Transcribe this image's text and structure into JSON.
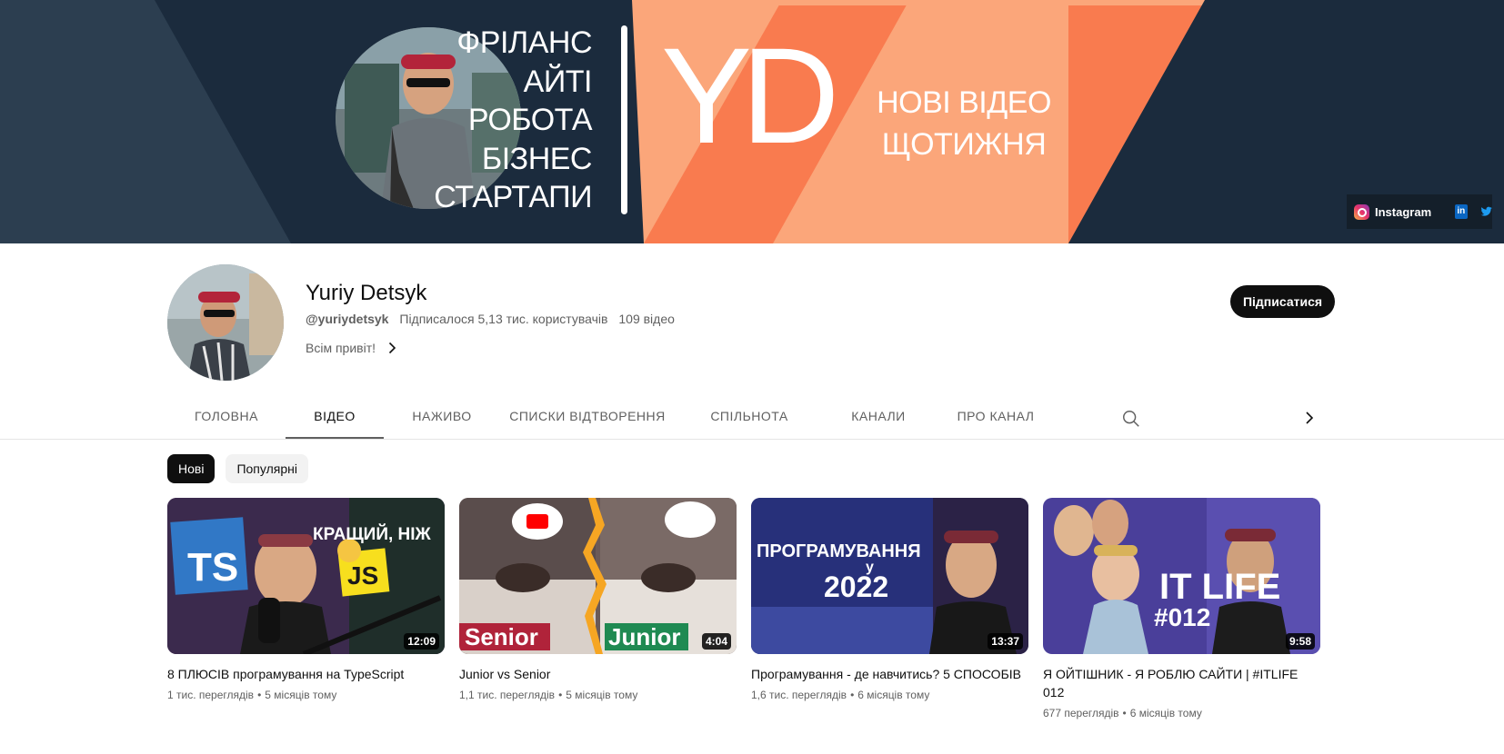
{
  "colors": {
    "banner_navy": "#1b2b3d",
    "banner_orange": "#f97b4f",
    "banner_peach": "#fba67a",
    "accent_dark": "#0f0f0f",
    "secondary_text": "#606060"
  },
  "banner": {
    "topics": [
      "ФРІЛАНС",
      "АЙТІ",
      "РОБОТА",
      "БІЗНЕС",
      "СТАРТАПИ"
    ],
    "logo": "YD",
    "new_videos": [
      "НОВІ ВІДЕО",
      "ЩОТИЖНЯ"
    ],
    "links": {
      "instagram_label": "Instagram",
      "linkedin_icon": "in",
      "twitter_icon": "twitter-icon"
    }
  },
  "channel": {
    "name": "Yuriy Detsyk",
    "handle": "@yuriydetsyk",
    "subscribers": "Підписалося 5,13 тис. користувачів",
    "video_count": "109 відео",
    "description": "Всім привіт!",
    "subscribe_label": "Підписатися"
  },
  "tabs": [
    {
      "label": "ГОЛОВНА",
      "active": false
    },
    {
      "label": "ВІДЕО",
      "active": true
    },
    {
      "label": "НАЖИВО",
      "active": false
    },
    {
      "label": "СПИСКИ ВІДТВОРЕННЯ",
      "active": false
    },
    {
      "label": "СПІЛЬНОТА",
      "active": false
    },
    {
      "label": "КАНАЛИ",
      "active": false
    },
    {
      "label": "ПРО КАНАЛ",
      "active": false
    }
  ],
  "chips": [
    {
      "label": "Нові",
      "active": true
    },
    {
      "label": "Популярні",
      "active": false
    }
  ],
  "videos": [
    {
      "title": "8 ПЛЮСІВ програмування на TypeScript",
      "views": "1 тис. переглядів",
      "age": "5 місяців тому",
      "duration": "12:09",
      "thumb_text": [
        "КРАЩИЙ, НІЖ",
        "TS",
        "JS"
      ]
    },
    {
      "title": "Junior vs Senior",
      "views": "1,1 тис. переглядів",
      "age": "5 місяців тому",
      "duration": "4:04",
      "thumb_text": [
        "Senior",
        "Junior"
      ]
    },
    {
      "title": "Програмування - де навчитись? 5 СПОСОБІВ",
      "views": "1,6 тис. переглядів",
      "age": "6 місяців тому",
      "duration": "13:37",
      "thumb_text": [
        "ПРОГРАМУВАННЯ",
        "у",
        "2022"
      ]
    },
    {
      "title": "Я ОЙТІШНИК - Я РОБЛЮ САЙТИ | #ITLIFE 012",
      "views": "677 переглядів",
      "age": "6 місяців тому",
      "duration": "9:58",
      "thumb_text": [
        "IT LIFE",
        "#012"
      ]
    }
  ],
  "separator": "•"
}
